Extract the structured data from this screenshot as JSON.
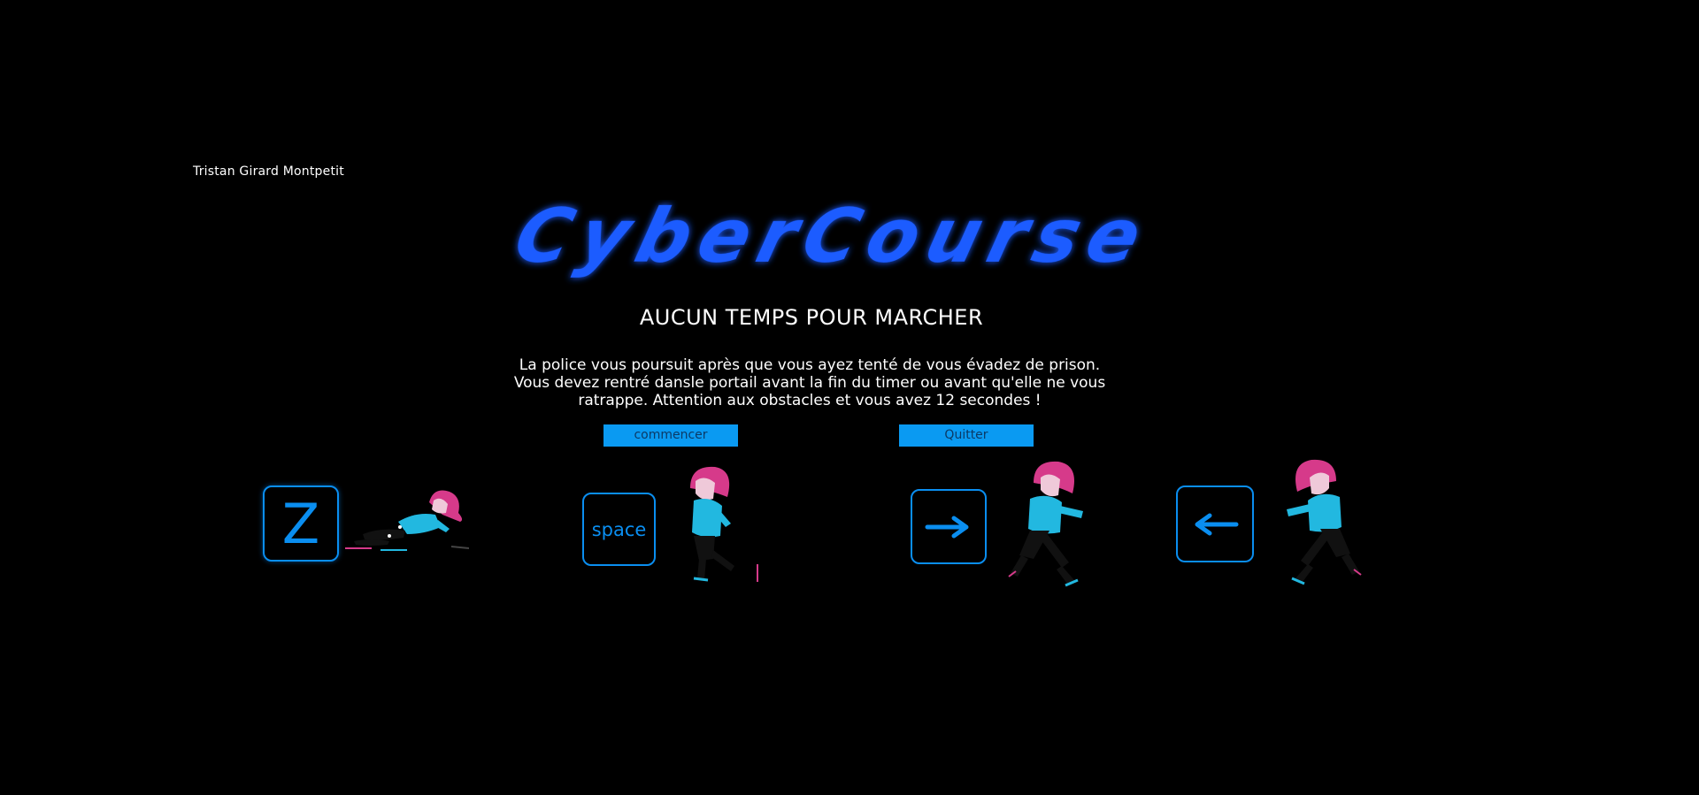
{
  "author": "Tristan Girard Montpetit",
  "logo": {
    "text": "CyberCourse"
  },
  "subtitle": "AUCUN TEMPS POUR MARCHER",
  "description": "La police vous poursuit après que vous ayez tenté de vous évadez de prison. Vous devez rentré dansle portail avant la fin du timer ou avant qu'elle ne vous ratrappe. Attention aux obstacles et vous avez 12 secondes !",
  "buttons": {
    "start": "commencer",
    "quit": "Quitter"
  },
  "controls": [
    {
      "key": "Z",
      "action_icon": "slide-character-icon"
    },
    {
      "key": "space",
      "action_icon": "jump-character-icon"
    },
    {
      "key": "→",
      "action_icon": "run-right-character-icon"
    },
    {
      "key": "←",
      "action_icon": "run-left-character-icon"
    }
  ],
  "colors": {
    "background": "#000000",
    "accent": "#0a8ef0",
    "logo": "#1a5cff",
    "button_bg": "#0a9af2",
    "button_text": "#0b3a66",
    "character_hair": "#d63a8a",
    "character_jacket": "#22b8e0"
  }
}
